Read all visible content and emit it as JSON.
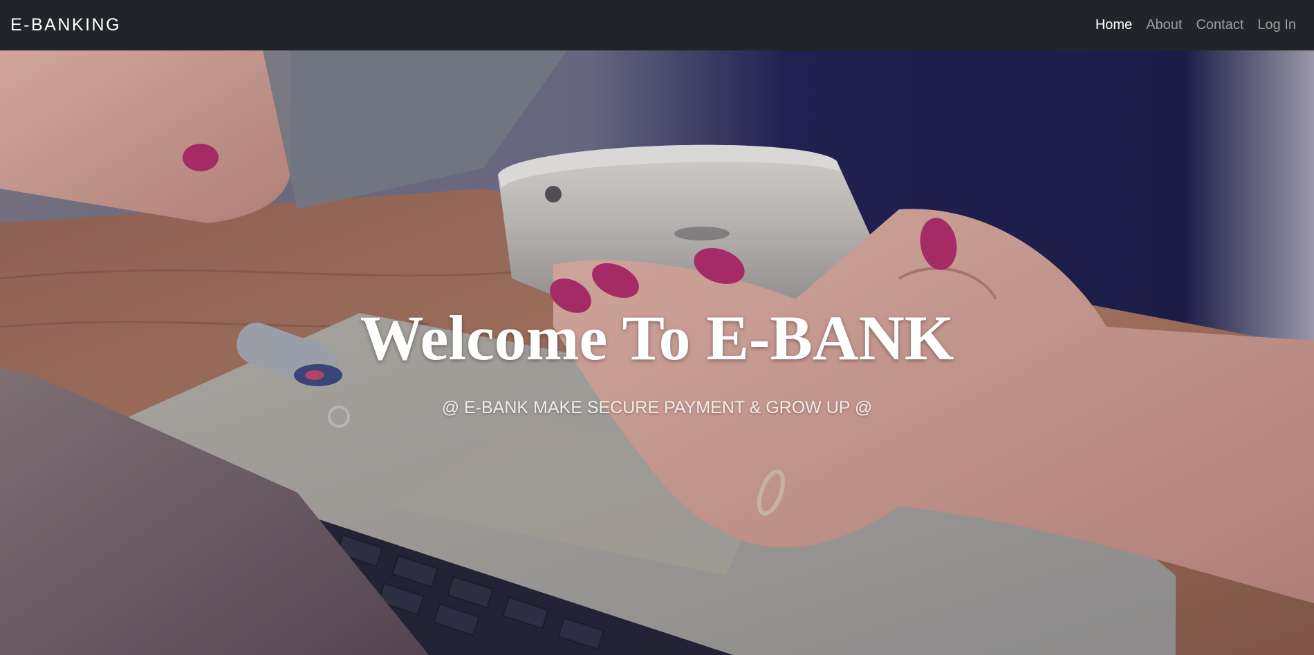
{
  "navbar": {
    "brand": "E-BANKING",
    "links": [
      {
        "label": "Home",
        "active": true
      },
      {
        "label": "About",
        "active": false
      },
      {
        "label": "Contact",
        "active": false
      },
      {
        "label": "Log In",
        "active": false
      }
    ],
    "background": "#212529"
  },
  "hero": {
    "title": "Welcome To E-BANK",
    "subtitle": "@ E-BANK MAKE SECURE PAYMENT & GROW UP @",
    "image_description_icon": "hand-holding-phone-over-laptop-image"
  }
}
